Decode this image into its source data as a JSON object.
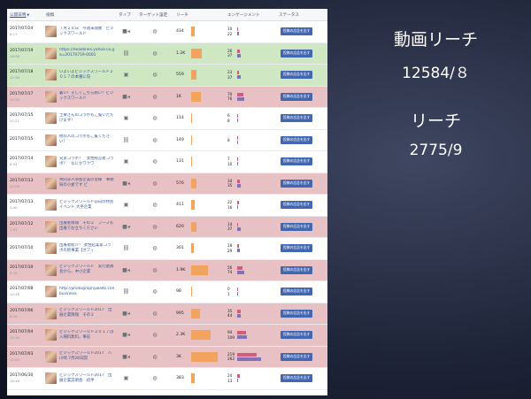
{
  "header": {
    "date": "公開日時",
    "sort_arrow": "▼",
    "post": "投稿",
    "type": "タイプ",
    "target": "ターゲット設定",
    "reach": "リーチ",
    "engagement": "エンゲージメント",
    "status": "ステータス"
  },
  "boost_label": "投稿の広告を出す",
  "side": {
    "line1": "動画リーチ",
    "line2": "12584/８",
    "line3": "リーチ",
    "line4": "2775/9"
  },
  "rows": [
    {
      "date": "2017/07/24",
      "time": "8:17",
      "text": "７月２８日　今週末開催　ビジックスワールド",
      "type": "video-icon",
      "reach": "434",
      "reach_pct": 0.12,
      "e1": "10",
      "e2": "22",
      "e1p": 0.03,
      "e2p": 0.05,
      "hl": ""
    },
    {
      "date": "2017/07/19",
      "time": "16:06",
      "text": "https://headlines.yahoo.co.jp/hl?a=20170719-0001",
      "type": "link-icon",
      "reach": "1.2K",
      "reach_pct": 0.33,
      "e1": "26",
      "e2": "37",
      "e1p": 0.07,
      "e2p": 0.1,
      "hl": "green"
    },
    {
      "date": "2017/07/18",
      "time": "22:38",
      "text": "いよいよビジックスワールド２０１７の本番に向",
      "type": "photo-icon",
      "reach": "559",
      "reach_pct": 0.16,
      "e1": "23",
      "e2": "37",
      "e1p": 0.06,
      "e2p": 0.1,
      "hl": "green"
    },
    {
      "date": "2017/07/17",
      "time": "10:20",
      "text": "暑い！そしてこちら熱い！ビジックスワールド",
      "type": "video-icon",
      "reach": "1K",
      "reach_pct": 0.3,
      "e1": "70",
      "e2": "76",
      "e1p": 0.2,
      "e2p": 0.22,
      "hl": "red"
    },
    {
      "date": "2017/07/15",
      "time": "20:21",
      "text": "土栗さんのコラボもご覧いただけます！",
      "type": "photo-icon",
      "reach": "114",
      "reach_pct": 0.03,
      "e1": "6",
      "e2": "8",
      "e1p": 0.02,
      "e2p": 0.02,
      "hl": ""
    },
    {
      "date": "2017/07/15",
      "time": "",
      "text": "他の人のコラボもご覧ください！",
      "type": "link-icon",
      "reach": "149",
      "reach_pct": 0.04,
      "e1": "8",
      "e2": "",
      "e1p": 0.02,
      "e2p": 0,
      "hl": ""
    },
    {
      "date": "2017/07/14",
      "time": "8:04",
      "text": "兄弟コラボ？　女性経営者コラボ？　なにかワクワ",
      "type": "photo-icon",
      "reach": "131",
      "reach_pct": 0.03,
      "e1": "7",
      "e2": "10",
      "e1p": 0.02,
      "e2p": 0.03,
      "hl": ""
    },
    {
      "date": "2017/07/13",
      "time": "10:09",
      "text": "共同求人参加企業の皆様　事務局の小倉です ビ",
      "type": "video-icon",
      "reach": "576",
      "reach_pct": 0.16,
      "e1": "34",
      "e2": "35",
      "e1p": 0.09,
      "e2p": 0.1,
      "hl": "red"
    },
    {
      "date": "2017/07/13",
      "time": "2:40",
      "text": "ビジックスワールド前日の特別イベント 大手企業",
      "type": "photo-icon",
      "reach": "411",
      "reach_pct": 0.11,
      "e1": "22",
      "e2": "16",
      "e1p": 0.06,
      "e2p": 0.04,
      "hl": ""
    },
    {
      "date": "2017/07/12",
      "time": "7:01",
      "text": "出展者情報　その２　ブースも出展でお立ちください",
      "type": "video-icon",
      "reach": "620",
      "reach_pct": 0.17,
      "e1": "14",
      "e2": "37",
      "e1p": 0.04,
      "e2p": 0.1,
      "hl": "red"
    },
    {
      "date": "2017/07/10",
      "time": "",
      "text": "出展者紹介！ 女性起業家コラボの新事業【オフィ",
      "type": "link-icon",
      "reach": "301",
      "reach_pct": 0.08,
      "e1": "18",
      "e2": "29",
      "e1p": 0.05,
      "e2p": 0.08,
      "hl": ""
    },
    {
      "date": "2017/07/10",
      "time": "8:15",
      "text": "ビジックスワールド　実行委員長から、中小企業",
      "type": "video-icon",
      "reach": "1.9K",
      "reach_pct": 0.52,
      "e1": "56",
      "e2": "74",
      "e1p": 0.16,
      "e2p": 0.21,
      "hl": "red"
    },
    {
      "date": "2017/07/08",
      "time": "10:48",
      "text": "http://photographywaltz.com/application-businese",
      "type": "link-icon",
      "reach": "98",
      "reach_pct": 0.02,
      "e1": "0",
      "e2": "1",
      "e1p": 0,
      "e2p": 0.01,
      "hl": ""
    },
    {
      "date": "2017/07/06",
      "time": "8:15",
      "text": "ビジックスワールド2017　出展企業情報　その２",
      "type": "video-icon",
      "reach": "995",
      "reach_pct": 0.27,
      "e1": "35",
      "e2": "44",
      "e1p": 0.1,
      "e2p": 0.12,
      "hl": "red"
    },
    {
      "date": "2017/07/04",
      "time": "12:34",
      "text": "ビジックスワールド２０１７は入場料無料。事前",
      "type": "video-icon",
      "reach": "2.3K",
      "reach_pct": 0.62,
      "e1": "94",
      "e2": "109",
      "e1p": 0.27,
      "e2p": 0.31,
      "hl": "red"
    },
    {
      "date": "2017/07/03",
      "time": "12:00",
      "text": "ビジックスワールド2017　八 川崎 7月28日開",
      "type": "video-icon",
      "reach": "3K",
      "reach_pct": 0.82,
      "e1": "219",
      "e2": "262",
      "e1p": 0.62,
      "e2p": 0.74,
      "hl": "red"
    },
    {
      "date": "2017/06/30",
      "time": "16:48",
      "text": "ビジックスワールド2017　出展企業説明会　初半",
      "type": "photo-icon",
      "reach": "383",
      "reach_pct": 0.1,
      "e1": "24",
      "e2": "13",
      "e1p": 0.07,
      "e2p": 0.04,
      "hl": ""
    }
  ]
}
